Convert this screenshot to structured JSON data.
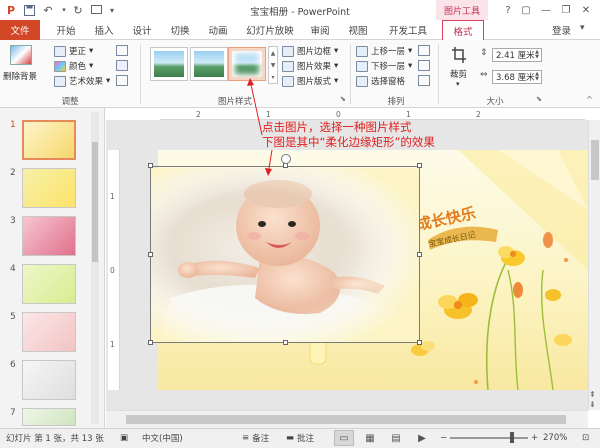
{
  "titlebar": {
    "app_title": "宝宝相册 - PowerPoint",
    "context_label": "图片工具",
    "qat_icons": [
      "powerpoint-logo-icon",
      "save-icon",
      "undo-icon",
      "redo-icon",
      "start-from-beginning-icon",
      "customize-qat-icon"
    ],
    "window_buttons": [
      "?",
      "▢",
      "—",
      "❐",
      "✕"
    ]
  },
  "tabs": [
    "文件",
    "开始",
    "插入",
    "设计",
    "切换",
    "动画",
    "幻灯片放映",
    "审阅",
    "视图",
    "开发工具",
    "格式"
  ],
  "active_tab": "格式",
  "login_label": "登录",
  "ribbon": {
    "adjust": {
      "remove_bg": "删除背景",
      "corrections": "更正",
      "color": "颜色",
      "artistic": "艺术效果",
      "label": "调整"
    },
    "styles": {
      "label": "图片样式",
      "border": "图片边框",
      "effects": "图片效果",
      "layout": "图片版式"
    },
    "arrange": {
      "label": "排列",
      "bring_forward": "上移一层",
      "send_backward": "下移一层",
      "selection_pane": "选择窗格"
    },
    "size": {
      "label": "大小",
      "crop": "裁剪",
      "height": "2.41 厘米",
      "width": "3.68 厘米"
    }
  },
  "ruler": {
    "h_ticks": [
      "2",
      "1",
      "0",
      "1",
      "2"
    ],
    "v_ticks": [
      "1",
      "0",
      "1"
    ]
  },
  "slides": [
    "1",
    "2",
    "3",
    "4",
    "5",
    "6",
    "7"
  ],
  "annotation": {
    "line1": "点击图片，选择一种图片样式",
    "line2": "下图是其中“柔化边缘矩形”的效果"
  },
  "slide_content": {
    "logo_text": "成长快乐",
    "ribbon_text": "宝宝成长日记"
  },
  "status": {
    "slide_info": "幻灯片 第 1 张，共 13 张",
    "language": "中文(中国)",
    "notes": "备注",
    "comments": "批注",
    "zoom": "270%",
    "zoom_fraction": 0.79
  },
  "colors": {
    "file_tab": "#d24726",
    "format_tab": "#c0304f",
    "annotation": "#e02020",
    "slide_bg": "#fcf4c5"
  }
}
